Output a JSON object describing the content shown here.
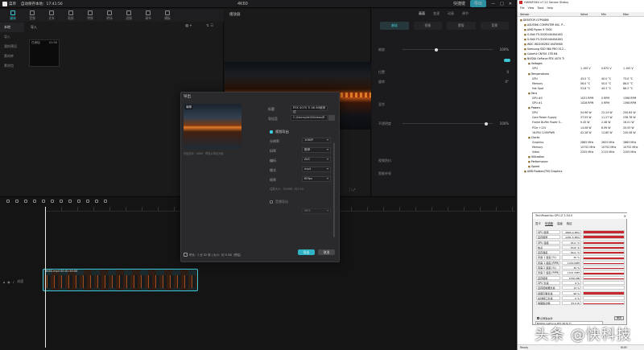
{
  "editor": {
    "titlebar": {
      "menu": "菜单",
      "autosave": "自动保存本地：17:41:56",
      "project_name": "4K60",
      "shortcut": "快捷键",
      "export_button": "导出"
    },
    "media_tabs": [
      {
        "label": "媒体",
        "active": true
      },
      {
        "label": "音频",
        "active": false
      },
      {
        "label": "文本",
        "active": false
      },
      {
        "label": "贴纸",
        "active": false
      },
      {
        "label": "特效",
        "active": false
      },
      {
        "label": "转场",
        "active": false
      },
      {
        "label": "滤镜",
        "active": false
      },
      {
        "label": "调节",
        "active": false
      },
      {
        "label": "模板",
        "active": false
      }
    ],
    "media_side": [
      "本地",
      "导入",
      "我的预设",
      "素材库",
      "素材包"
    ],
    "media_header": "导入",
    "media_thumb": {
      "badge": "已添加",
      "duration": "01:50"
    },
    "player": {
      "title": "播放器"
    },
    "inspector": {
      "tabs": [
        "画面",
        "变速",
        "动画",
        "调节"
      ],
      "active_tab": "画面",
      "sub_tabs": [
        "基础",
        "抠像",
        "蒙版",
        "背景"
      ],
      "active_sub": "基础",
      "rows": [
        {
          "label": "缩放",
          "value": "100%",
          "pos": 0.5
        },
        {
          "label": "位置",
          "value": "0",
          "pos": 0
        },
        {
          "label": "旋转",
          "value": "0°",
          "pos": 0
        },
        {
          "label": "混合",
          "value": "",
          "pos": 0
        },
        {
          "label": "不透明度",
          "value": "100%",
          "pos": 1
        },
        {
          "label": "视频防抖",
          "value": "",
          "pos": 0
        },
        {
          "label": "智能补帧",
          "value": "",
          "pos": 0
        }
      ]
    },
    "timeline": {
      "track_label": "封面",
      "clip_name": "4K60.mp4  00:01:50:00"
    }
  },
  "export_dialog": {
    "title": "导出",
    "preview_edit": "编辑",
    "preview_caption": "作品名字：4K60  · 预览以导出为准",
    "fields": [
      {
        "label": "标题",
        "value": "RTX 4070 Ti 4K 60帧测试"
      },
      {
        "label": "导出至",
        "value": "C:/Users/dell/Videos/R"
      }
    ],
    "video_section": "视频导出",
    "video_options": [
      {
        "label": "分辨率",
        "value": "1080P"
      },
      {
        "label": "码率",
        "value": "推荐"
      },
      {
        "label": "编码",
        "value": "AVC"
      },
      {
        "label": "格式",
        "value": "mp4"
      },
      {
        "label": "帧率",
        "value": "60fps"
      }
    ],
    "estimate": "估算大小：524MB  · 约1:50",
    "audio_section": "音频导出",
    "audio_format": "MP3",
    "footer_info": "时长：1 分 52 秒  | 大小：约 9 GB（预估）",
    "export_button": "导出",
    "cancel_button": "取消",
    "colors": {
      "accent": "#2fb3c4"
    }
  },
  "hwinfo": {
    "title": "HWiNFO64 v7.22 Sensor Status",
    "menu": [
      "File",
      "View",
      "Tools",
      "Help"
    ],
    "columns": [
      "Sensor",
      "Value",
      "Min",
      "Max"
    ],
    "rows": [
      {
        "indent": 0,
        "name": "DESKTOP-G7PO0B6",
        "v": "",
        "min": "",
        "max": ""
      },
      {
        "indent": 1,
        "name": "ASUSTeK COMPUTER INC. P...",
        "v": "",
        "min": "",
        "max": ""
      },
      {
        "indent": 1,
        "name": "AMD Ryzen 9 7900",
        "v": "",
        "min": "",
        "max": ""
      },
      {
        "indent": 1,
        "name": "G.Skill F5-5200U4040A16G",
        "v": "",
        "min": "",
        "max": ""
      },
      {
        "indent": 1,
        "name": "G.Skill F5-5200U4040A16G",
        "v": "",
        "min": "",
        "max": ""
      },
      {
        "indent": 1,
        "name": "WDC WD20EZRZ-00Z5HB0",
        "v": "",
        "min": "",
        "max": ""
      },
      {
        "indent": 1,
        "name": "Samsung SSD 980 PRO 512...",
        "v": "",
        "min": "",
        "max": ""
      },
      {
        "indent": 1,
        "name": "Colorful CN700 1TB M4",
        "v": "",
        "min": "",
        "max": ""
      },
      {
        "indent": 1,
        "name": "NVIDIA GeForce RTX 4070 Ti",
        "v": "",
        "min": "",
        "max": ""
      },
      {
        "indent": 2,
        "name": "Voltages",
        "v": "",
        "min": "",
        "max": ""
      },
      {
        "indent": 3,
        "name": "GPU",
        "v": "1.100 V",
        "min": "0.870 V",
        "max": "1.100 V"
      },
      {
        "indent": 2,
        "name": "Temperatures",
        "v": "",
        "min": "",
        "max": ""
      },
      {
        "indent": 3,
        "name": "GPU",
        "v": "45.0 °C",
        "min": "40.0 °C",
        "max": "73.0 °C"
      },
      {
        "indent": 3,
        "name": "Memory",
        "v": "56.0 °C",
        "min": "50.0 °C",
        "max": "86.0 °C"
      },
      {
        "indent": 3,
        "name": "Hot Spot",
        "v": "53.8 °C",
        "min": "49.3 °C",
        "max": "86.3 °C"
      },
      {
        "indent": 2,
        "name": "Fans",
        "v": "",
        "min": "",
        "max": ""
      },
      {
        "indent": 3,
        "name": "GPU #0",
        "v": "1031 RPM",
        "min": "0 RPM",
        "max": "1398 RPM"
      },
      {
        "indent": 3,
        "name": "GPU #1",
        "v": "1028 RPM",
        "min": "0 RPM",
        "max": "1398 RPM"
      },
      {
        "indent": 2,
        "name": "Powers",
        "v": "",
        "min": "",
        "max": ""
      },
      {
        "indent": 3,
        "name": "GPU",
        "v": "54.96 W",
        "min": "22.24 W",
        "max": "250.84 W"
      },
      {
        "indent": 3,
        "name": "Core Power Supply",
        "v": "37.55 W",
        "min": "11.27 W",
        "max": "236.78 W"
      },
      {
        "indent": 3,
        "name": "Frame Buffer Power S...",
        "v": "9.45 W",
        "min": "2.48 W",
        "max": "16.01 W"
      },
      {
        "indent": 3,
        "name": "PCIe +12V",
        "v": "14.08 W",
        "min": "8.99 W",
        "max": "20.93 W"
      },
      {
        "indent": 3,
        "name": "16-PIN 12VHPWR",
        "v": "42.28 W",
        "min": "12.80 W",
        "max": "245.08 W"
      },
      {
        "indent": 2,
        "name": "Clocks",
        "v": "",
        "min": "",
        "max": ""
      },
      {
        "indent": 3,
        "name": "Graphics",
        "v": "2865 MHz",
        "min": "2625 MHz",
        "max": "2865 MHz"
      },
      {
        "indent": 3,
        "name": "Memory",
        "v": "10752 MHz",
        "min": "10752 MHz",
        "max": "10752 MHz"
      },
      {
        "indent": 3,
        "name": "Video",
        "v": "2205 MHz",
        "min": "2115 MHz",
        "max": "2205 MHz"
      },
      {
        "indent": 2,
        "name": "Utilization",
        "v": "",
        "min": "",
        "max": ""
      },
      {
        "indent": 2,
        "name": "Performance",
        "v": "",
        "min": "",
        "max": ""
      },
      {
        "indent": 2,
        "name": "Speed",
        "v": "",
        "min": "",
        "max": ""
      },
      {
        "indent": 1,
        "name": "AMD Radeon(TM) Graphics",
        "v": "",
        "min": "",
        "max": ""
      }
    ],
    "status_left": "Ready",
    "status_right": "NUM"
  },
  "gpuz": {
    "title": "TechPowerUp GPU-Z 2.54.0",
    "tabs": [
      "显卡",
      "传感器",
      "高级",
      "验证"
    ],
    "active_tab": "传感器",
    "rows": [
      {
        "label": "GPU 频率",
        "value": "2865.0 MHz",
        "level": 0.92
      },
      {
        "label": "显存频率",
        "value": "1281.5 MHz",
        "level": 0.95
      },
      {
        "label": "GPU 温度",
        "value": "45.0 °C",
        "level": 0.55
      },
      {
        "label": "热点",
        "value": "53.8 °C",
        "level": 0.6
      },
      {
        "label": "显存温度",
        "value": "56.0 °C",
        "level": 0.62
      },
      {
        "label": "风扇 1 速度 (%)",
        "value": "30 %",
        "level": 0.45
      },
      {
        "label": "风扇 1 速度 (RPM)",
        "value": "1030 RPM",
        "level": 0.45
      },
      {
        "label": "风扇 2 速度 (%)",
        "value": "30 %",
        "level": 0.45
      },
      {
        "label": "风扇 2 速度 (RPM)",
        "value": "1031 RPM",
        "level": 0.45
      },
      {
        "label": "显存使用",
        "value": "1550 MB",
        "level": 0.3
      },
      {
        "label": "GPU 负载",
        "value": "9 %",
        "level": 0.2
      },
      {
        "label": "显存控制器负载",
        "value": "12 %",
        "level": 0.25
      },
      {
        "label": "视频引擎负载",
        "value": "96 %",
        "level": 0.96
      },
      {
        "label": "总线接口负载",
        "value": "0 %",
        "level": 0.05
      },
      {
        "label": "电路板功耗",
        "value": "55.0 W",
        "level": 0.35
      }
    ],
    "log_label": "记录到文件",
    "reset_label": "重置",
    "card_name": "NVIDIA GeForce RTX 4070 Ti"
  },
  "watermark": "头条 @快科技"
}
